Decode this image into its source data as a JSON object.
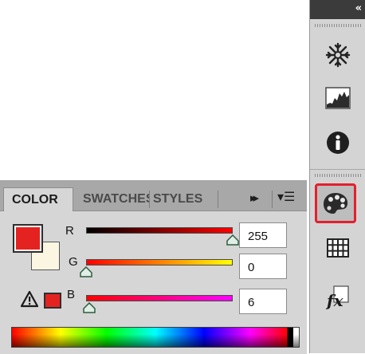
{
  "dock": {
    "collapse_glyph": "«",
    "tools": [
      {
        "name": "brushes",
        "icon": "snowflake-icon",
        "active": false
      },
      {
        "name": "histogram",
        "icon": "histogram-icon",
        "active": false
      },
      {
        "name": "info",
        "icon": "info-icon",
        "active": false
      },
      {
        "name": "color",
        "icon": "palette-icon",
        "active": true
      },
      {
        "name": "swatches",
        "icon": "grid-icon",
        "active": false
      },
      {
        "name": "styles",
        "icon": "fx-icon",
        "active": false
      }
    ]
  },
  "panel": {
    "tabs": [
      {
        "label": "COLOR",
        "active": true
      },
      {
        "label": "SWATCHES",
        "active": false
      },
      {
        "label": "STYLES",
        "active": false
      }
    ],
    "expand_glyph": "▸▸",
    "menu_glyph": "▾☰",
    "foreground_color": "#e42321",
    "background_color": "#fbf6e2",
    "gamut_warning_color": "#e42321",
    "sliders": [
      {
        "channel": "R",
        "value": "255",
        "fraction": 1.0
      },
      {
        "channel": "G",
        "value": "0",
        "fraction": 0.0
      },
      {
        "channel": "B",
        "value": "6",
        "fraction": 0.0235
      }
    ]
  }
}
